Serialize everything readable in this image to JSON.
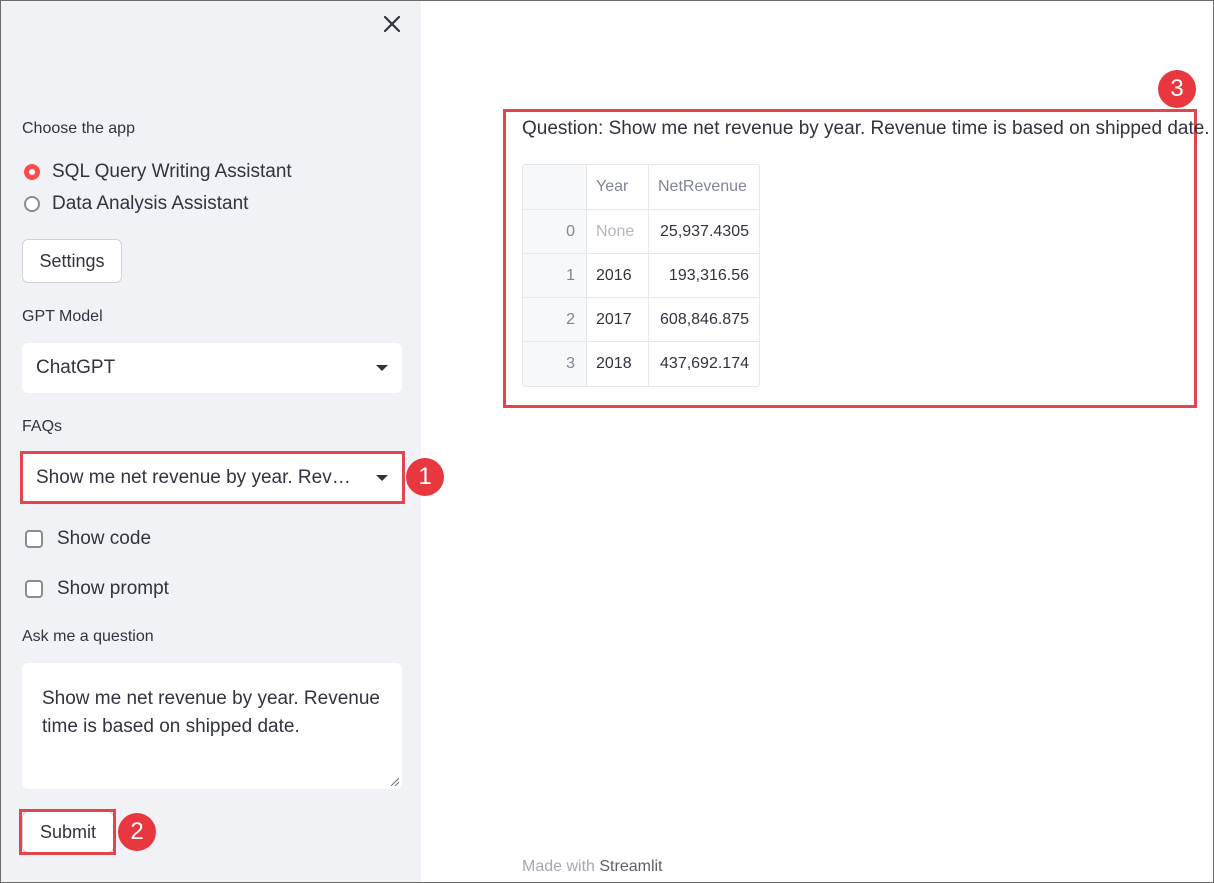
{
  "sidebar": {
    "app_label": "Choose the app",
    "apps": [
      {
        "label": "SQL Query Writing Assistant",
        "selected": true
      },
      {
        "label": "Data Analysis Assistant",
        "selected": false
      }
    ],
    "settings_button": "Settings",
    "model_label": "GPT Model",
    "model_value": "ChatGPT",
    "faq_label": "FAQs",
    "faq_value": "Show me net revenue by year. Revenue time is based on shipped date.",
    "show_code_label": "Show code",
    "show_prompt_label": "Show prompt",
    "question_label": "Ask me a question",
    "question_value": "Show me net revenue by year. Revenue time is based on shipped date.",
    "submit_button": "Submit"
  },
  "main": {
    "question_text": "Question: Show me net revenue by year. Revenue time is based on shipped date.",
    "table": {
      "columns": [
        "",
        "Year",
        "NetRevenue"
      ],
      "rows": [
        {
          "index": "0",
          "year": "None",
          "net_revenue": "25,937.4305"
        },
        {
          "index": "1",
          "year": "2016",
          "net_revenue": "193,316.56"
        },
        {
          "index": "2",
          "year": "2017",
          "net_revenue": "608,846.875"
        },
        {
          "index": "3",
          "year": "2018",
          "net_revenue": "437,692.174"
        }
      ]
    },
    "footer_prefix": "Made with",
    "footer_brand": "Streamlit"
  },
  "callouts": [
    "1",
    "2",
    "3"
  ],
  "colors": {
    "accent": "#ff4b4b",
    "highlight": "#e0474c",
    "sidebar_bg": "#f0f2f6",
    "text": "#31333f"
  },
  "icons": {
    "close": "close-icon",
    "dropdown": "caret-down-icon",
    "resize": "resize-grip-icon"
  }
}
